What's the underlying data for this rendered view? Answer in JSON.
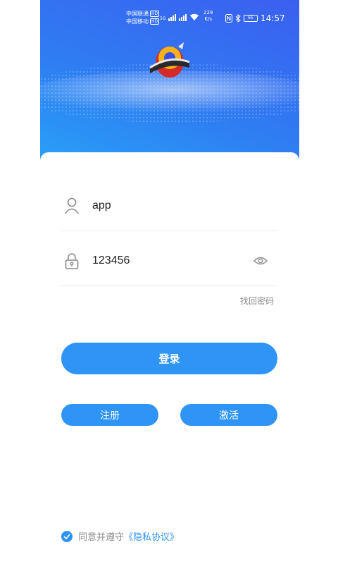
{
  "status_bar": {
    "carrier_1": "中国联通",
    "carrier_2": "中国移动",
    "hd_badge": "HD",
    "network": "5G",
    "speed_value": "229",
    "speed_unit": "K/s",
    "battery": "65",
    "time": "14:57"
  },
  "login": {
    "username": "app",
    "password": "123456",
    "forgot_password": "找回密码",
    "login_button": "登录",
    "register_button": "注册",
    "activate_button": "激活",
    "agree_text": "同意并遵守",
    "privacy_link": "《隐私协议》"
  },
  "icons": {
    "user": "user-icon",
    "lock": "lock-icon",
    "eye": "eye-icon",
    "check": "check-icon",
    "logo": "app-logo"
  },
  "colors": {
    "primary": "#2e94f5",
    "hero_top": "#3b5ff0",
    "hero_bottom": "#28a2f7"
  }
}
